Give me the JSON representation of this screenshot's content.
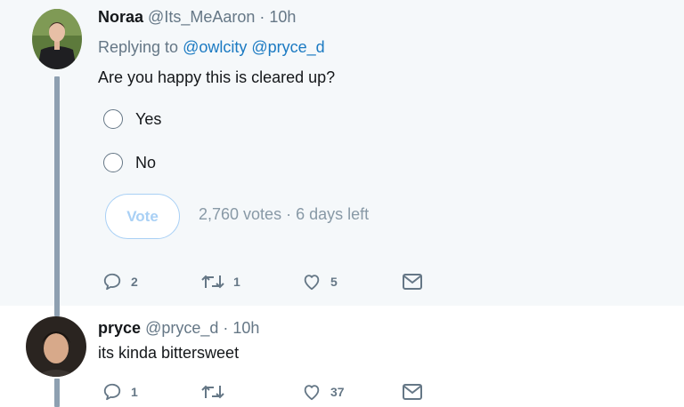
{
  "tweets": [
    {
      "name": "Noraa",
      "handle": "@Its_MeAaron",
      "separator": "·",
      "time": "10h",
      "replying_prefix": "Replying to",
      "replying_to": [
        "@owlcity",
        "@pryce_d"
      ],
      "text": "Are you happy this is cleared up?",
      "poll": {
        "options": [
          "Yes",
          "No"
        ],
        "vote_label": "Vote",
        "votes": "2,760 votes",
        "time_left": "6 days left"
      },
      "actions": {
        "replies": "2",
        "retweets": "1",
        "likes": "5"
      }
    },
    {
      "name": "pryce",
      "handle": "@pryce_d",
      "separator": "·",
      "time": "10h",
      "text": "its kinda bittersweet",
      "actions": {
        "replies": "1",
        "retweets": "",
        "likes": "37"
      }
    }
  ],
  "colors": {
    "background_highlight": "#f5f8fa",
    "mention_blue": "#1b7ac2",
    "muted_text": "#657786",
    "thread_line": "#8ea0b1",
    "vote_button": "#a9d0f5"
  },
  "icons": [
    "reply-icon",
    "retweet-icon",
    "like-icon",
    "direct-message-icon",
    "radio-circle"
  ]
}
